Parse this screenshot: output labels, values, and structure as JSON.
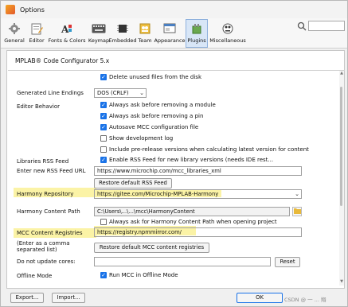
{
  "window": {
    "title": "Options"
  },
  "toolbar": {
    "items": [
      {
        "label": "General"
      },
      {
        "label": "Editor"
      },
      {
        "label": "Fonts & Colors"
      },
      {
        "label": "Keymap"
      },
      {
        "label": "Embedded"
      },
      {
        "label": "Team"
      },
      {
        "label": "Appearance"
      },
      {
        "label": "Plugins"
      },
      {
        "label": "Miscellaneous"
      }
    ],
    "active": "Plugins",
    "search_value": ""
  },
  "panel": {
    "section_title": "MPLAB® Code Configurator 5.x",
    "delete_unused": "Delete unused files from the disk",
    "line_endings_label": "Generated Line Endings",
    "line_endings_value": "DOS (CRLF)",
    "editor_behavior_label": "Editor Behavior",
    "ask_remove_module": "Always ask before removing a module",
    "ask_remove_pin": "Always ask before removing a pin",
    "autosave": "Autosave MCC configuration file",
    "show_dev_log": "Show development log",
    "include_prerelease": "Include pre-release versions when calculating latest version for content",
    "libraries_rss_label": "Libraries RSS Feed",
    "enable_rss": "Enable RSS Feed for new library versions (needs IDE rest...",
    "rss_url_label": "Enter new  RSS Feed URL",
    "rss_url_value": "https://www.microchip.com/mcc_libraries_xml",
    "restore_rss_button": "Restore default RSS Feed",
    "harmony_repo_label": "Harmony Repository",
    "harmony_repo_value": "https://gitee.com/Microchip-MPLAB-Harmony",
    "harmony_path_label": "Harmony Content Path",
    "harmony_path_value": "C:\\Users\\...\\...\\mcc\\HarmonyContent",
    "ask_harmony_path": "Always ask for Harmony Content Path when opening project",
    "mcc_registries_label": "MCC Content Registries",
    "mcc_registries_value": "https://registry.npmmirror.com/",
    "comma_hint": "(Enter as a comma separated list)",
    "restore_registries_button": "Restore default MCC content registries",
    "do_not_update_label": "Do not update cores:",
    "do_not_update_value": "",
    "reset_button": "Reset",
    "offline_mode_label": "Offline Mode",
    "run_offline": "Run MCC in Offline Mode"
  },
  "footer": {
    "export_button": "Export...",
    "import_button": "Import...",
    "ok_button": "OK",
    "watermark": "CSDN @ 一 ... 翔"
  },
  "colors": {
    "highlight": "#fbf3a6",
    "checkbox": "#1a73e8",
    "active_tab": "#d8e6f7"
  }
}
